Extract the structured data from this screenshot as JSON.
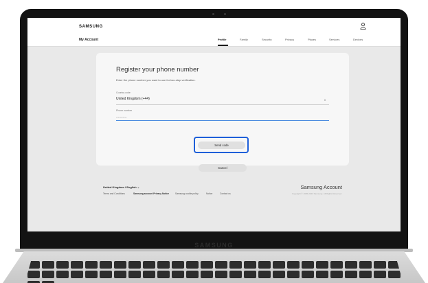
{
  "header": {
    "brand": "SAMSUNG",
    "section_title": "My Account",
    "nav": [
      "Profile",
      "Family",
      "Security",
      "Privacy",
      "Places",
      "Services",
      "Devices"
    ],
    "active_nav": "Profile",
    "user_icon": "person-icon"
  },
  "form": {
    "title": "Register your phone number",
    "description": "Enter the phone number you want to use for two-step verification.",
    "country_label": "Country code",
    "country_value": "United Kingdom (+44)",
    "phone_label": "Phone number",
    "phone_value": "•••••••••••",
    "send_code_label": "Send code",
    "cancel_label": "Cancel"
  },
  "footer": {
    "locale": "United Kingdom / English",
    "links": [
      "Terms and Conditions",
      "Samsung account Privacy Notice",
      "Samsung cookie policy",
      "Notice",
      "Contact us"
    ],
    "brand": "Samsung Account",
    "copyright": "Copyright © 1995-2023 Samsung. All Rights Reserved."
  },
  "device": {
    "bezel_brand": "SAMSUNG"
  },
  "colors": {
    "focus_ring": "#1e5fd9",
    "active_input_underline": "#4a8be0"
  }
}
